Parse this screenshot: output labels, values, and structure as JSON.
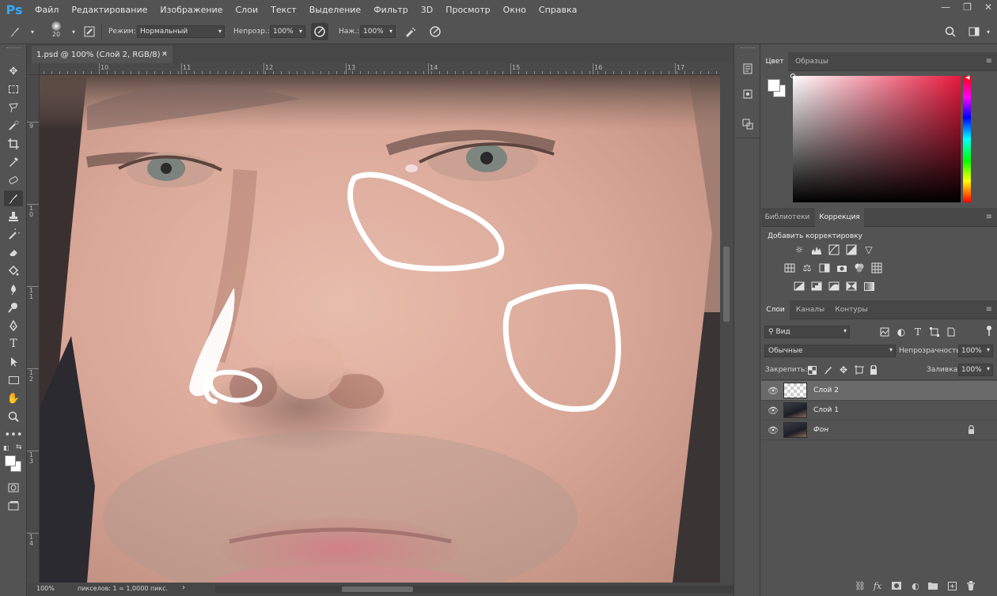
{
  "app": {
    "logo": "Ps"
  },
  "menu": [
    "Файл",
    "Редактирование",
    "Изображение",
    "Слои",
    "Текст",
    "Выделение",
    "Фильтр",
    "3D",
    "Просмотр",
    "Окно",
    "Справка"
  ],
  "window_controls": {
    "minimize": "—",
    "restore": "❐",
    "close": "✕"
  },
  "options": {
    "brush_size": "20",
    "mode_label": "Режим:",
    "mode_value": "Нормальный",
    "opacity_label": "Непрозр.:",
    "opacity_value": "100%",
    "pressure_label": "Наж.:",
    "pressure_value": "100%"
  },
  "document": {
    "tab_title": "1.psd @ 100% (Слой 2, RGB/8) *",
    "close": "×",
    "ruler_h": [
      "10",
      "11",
      "12",
      "13",
      "14",
      "15",
      "16",
      "17"
    ],
    "ruler_v": [
      "9",
      "1 0",
      "1 1",
      "1 2",
      "1 3",
      "1 4"
    ]
  },
  "status": {
    "zoom": "100%",
    "info": "пикселов: 1 = 1,0000 пикс.",
    "arrow": "›"
  },
  "color_panel": {
    "tabs": [
      "Цвет",
      "Образцы"
    ],
    "active_tab": "Цвет",
    "foreground": "#ffffff",
    "background": "#ffffff"
  },
  "adjust_panel": {
    "tabs": [
      "Библиотеки",
      "Коррекция"
    ],
    "active_tab": "Коррекция",
    "title": "Добавить корректировку"
  },
  "layers_panel": {
    "tabs": [
      "Слои",
      "Каналы",
      "Контуры"
    ],
    "active_tab": "Слои",
    "filter_kind": "Вид",
    "blend_mode": "Обычные",
    "opacity_label": "Непрозрачность:",
    "opacity_value": "100%",
    "lock_label": "Закрепить:",
    "fill_label": "Заливка:",
    "fill_value": "100%",
    "layers": [
      {
        "name": "Слой 2",
        "selected": true,
        "thumb": "transparent",
        "locked": false
      },
      {
        "name": "Слой 1",
        "selected": false,
        "thumb": "photo",
        "locked": false
      },
      {
        "name": "Фон",
        "selected": false,
        "thumb": "photo",
        "locked": true
      }
    ]
  }
}
